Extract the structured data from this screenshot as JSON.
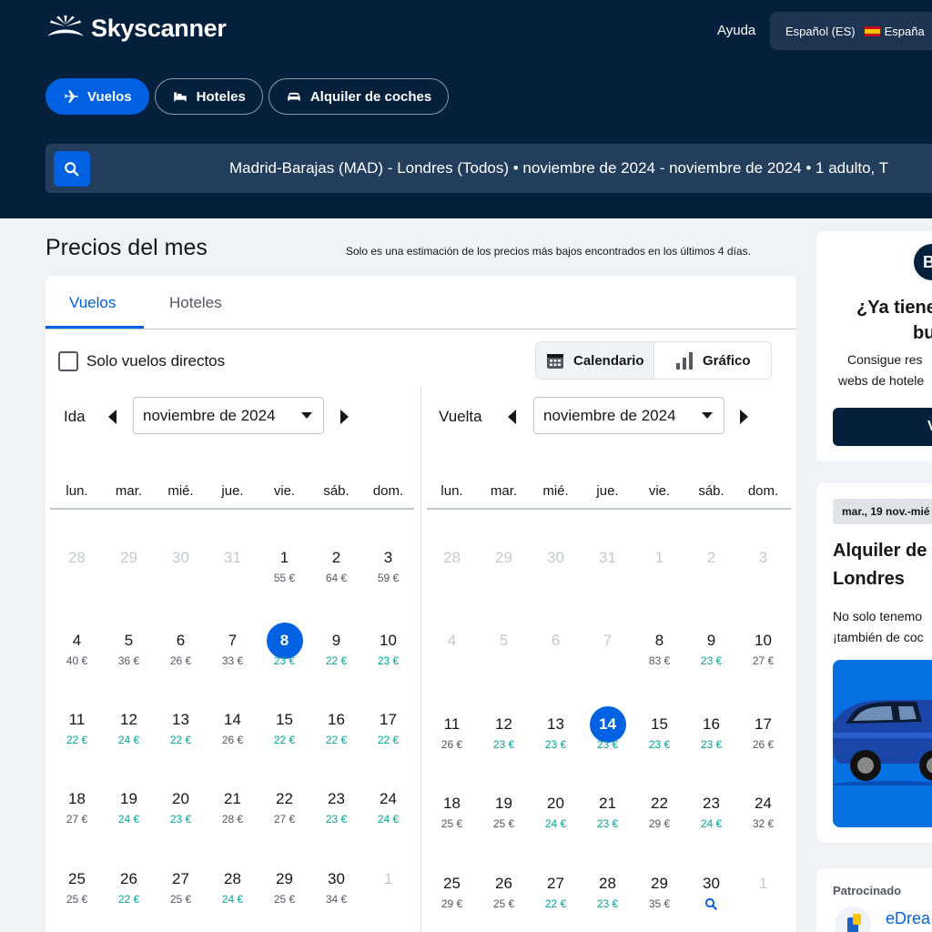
{
  "header": {
    "brand": "Skyscanner",
    "help": "Ayuda",
    "language": "Español (ES)",
    "country": "España",
    "colors": {
      "background": "#05203c",
      "accent": "#0062e3"
    }
  },
  "nav": [
    {
      "label": "Vuelos",
      "icon": "plane-icon",
      "active": true
    },
    {
      "label": "Hoteles",
      "icon": "bed-icon",
      "active": false
    },
    {
      "label": "Alquiler de coches",
      "icon": "car-icon",
      "active": false
    }
  ],
  "search": {
    "summary": "Madrid-Barajas (MAD) - Londres (Todos)  •  noviembre de 2024 - noviembre de 2024  •  1 adulto, T"
  },
  "main": {
    "title": "Precios del mes",
    "note": "Solo es una estimación de los precios más bajos encontrados en los últimos 4 días.",
    "tabs": [
      "Vuelos",
      "Hoteles"
    ],
    "direct_only": "Solo vuelos directos",
    "view_calendar": "Calendario",
    "view_chart": "Gráfico"
  },
  "weekdays": [
    "lun.",
    "mar.",
    "mié.",
    "jue.",
    "vie.",
    "sáb.",
    "dom."
  ],
  "outbound": {
    "label": "Ida",
    "month": "noviembre de 2024",
    "weeks": [
      [
        {
          "d": "28",
          "m": true
        },
        {
          "d": "29",
          "m": true
        },
        {
          "d": "30",
          "m": true
        },
        {
          "d": "31",
          "m": true
        },
        {
          "d": "1",
          "p": "55 €"
        },
        {
          "d": "2",
          "p": "64 €"
        },
        {
          "d": "3",
          "p": "59 €"
        }
      ],
      [
        {
          "d": "4",
          "p": "40 €"
        },
        {
          "d": "5",
          "p": "36 €"
        },
        {
          "d": "6",
          "p": "26 €"
        },
        {
          "d": "7",
          "p": "33 €"
        },
        {
          "d": "8",
          "p": "23 €",
          "g": true,
          "s": true
        },
        {
          "d": "9",
          "p": "22 €",
          "g": true
        },
        {
          "d": "10",
          "p": "23 €",
          "g": true
        }
      ],
      [
        {
          "d": "11",
          "p": "22 €",
          "g": true
        },
        {
          "d": "12",
          "p": "24 €",
          "g": true
        },
        {
          "d": "13",
          "p": "22 €",
          "g": true
        },
        {
          "d": "14",
          "p": "26 €"
        },
        {
          "d": "15",
          "p": "22 €",
          "g": true
        },
        {
          "d": "16",
          "p": "22 €",
          "g": true
        },
        {
          "d": "17",
          "p": "22 €",
          "g": true
        }
      ],
      [
        {
          "d": "18",
          "p": "27 €"
        },
        {
          "d": "19",
          "p": "24 €",
          "g": true
        },
        {
          "d": "20",
          "p": "23 €",
          "g": true
        },
        {
          "d": "21",
          "p": "28 €"
        },
        {
          "d": "22",
          "p": "27 €"
        },
        {
          "d": "23",
          "p": "23 €",
          "g": true
        },
        {
          "d": "24",
          "p": "24 €",
          "g": true
        }
      ],
      [
        {
          "d": "25",
          "p": "25 €"
        },
        {
          "d": "26",
          "p": "22 €",
          "g": true
        },
        {
          "d": "27",
          "p": "25 €"
        },
        {
          "d": "28",
          "p": "24 €",
          "g": true
        },
        {
          "d": "29",
          "p": "25 €"
        },
        {
          "d": "30",
          "p": "34 €"
        },
        {
          "d": "1",
          "m": true
        }
      ]
    ]
  },
  "return": {
    "label": "Vuelta",
    "month": "noviembre de 2024",
    "weeks": [
      [
        {
          "d": "28",
          "m": true
        },
        {
          "d": "29",
          "m": true
        },
        {
          "d": "30",
          "m": true
        },
        {
          "d": "31",
          "m": true
        },
        {
          "d": "1",
          "m": true
        },
        {
          "d": "2",
          "m": true
        },
        {
          "d": "3",
          "m": true
        }
      ],
      [
        {
          "d": "4",
          "m": true
        },
        {
          "d": "5",
          "m": true
        },
        {
          "d": "6",
          "m": true
        },
        {
          "d": "7",
          "m": true
        },
        {
          "d": "8",
          "p": "83 €"
        },
        {
          "d": "9",
          "p": "23 €",
          "g": true
        },
        {
          "d": "10",
          "p": "27 €"
        }
      ],
      [
        {
          "d": "11",
          "p": "26 €"
        },
        {
          "d": "12",
          "p": "23 €",
          "g": true
        },
        {
          "d": "13",
          "p": "23 €",
          "g": true
        },
        {
          "d": "14",
          "p": "23 €",
          "g": true,
          "s": true
        },
        {
          "d": "15",
          "p": "23 €",
          "g": true
        },
        {
          "d": "16",
          "p": "23 €",
          "g": true
        },
        {
          "d": "17",
          "p": "26 €"
        }
      ],
      [
        {
          "d": "18",
          "p": "25 €"
        },
        {
          "d": "19",
          "p": "25 €"
        },
        {
          "d": "20",
          "p": "24 €",
          "g": true
        },
        {
          "d": "21",
          "p": "23 €",
          "g": true
        },
        {
          "d": "22",
          "p": "29 €"
        },
        {
          "d": "23",
          "p": "24 €",
          "g": true
        },
        {
          "d": "24",
          "p": "32 €"
        }
      ],
      [
        {
          "d": "25",
          "p": "29 €"
        },
        {
          "d": "26",
          "p": "25 €"
        },
        {
          "d": "27",
          "p": "22 €",
          "g": true
        },
        {
          "d": "28",
          "p": "23 €",
          "g": true
        },
        {
          "d": "29",
          "p": "35 €"
        },
        {
          "d": "30",
          "icon": "search-icon"
        },
        {
          "d": "1",
          "m": true
        }
      ]
    ]
  },
  "sidebar": {
    "promo_badge": "B",
    "promo_title_1": "¿Ya tiene",
    "promo_title_2": "bu",
    "promo_text_1": "Consigue res",
    "promo_text_2": "webs de hotele",
    "promo_button": "V",
    "car_dates": "mar., 19 nov.-mié",
    "car_title_1": "Alquiler de",
    "car_title_2": "Londres",
    "car_text_1": "No solo tenemo",
    "car_text_2": "¡también de coc",
    "sponsored": "Patrocinado",
    "sponsor_name": "eDrea"
  }
}
